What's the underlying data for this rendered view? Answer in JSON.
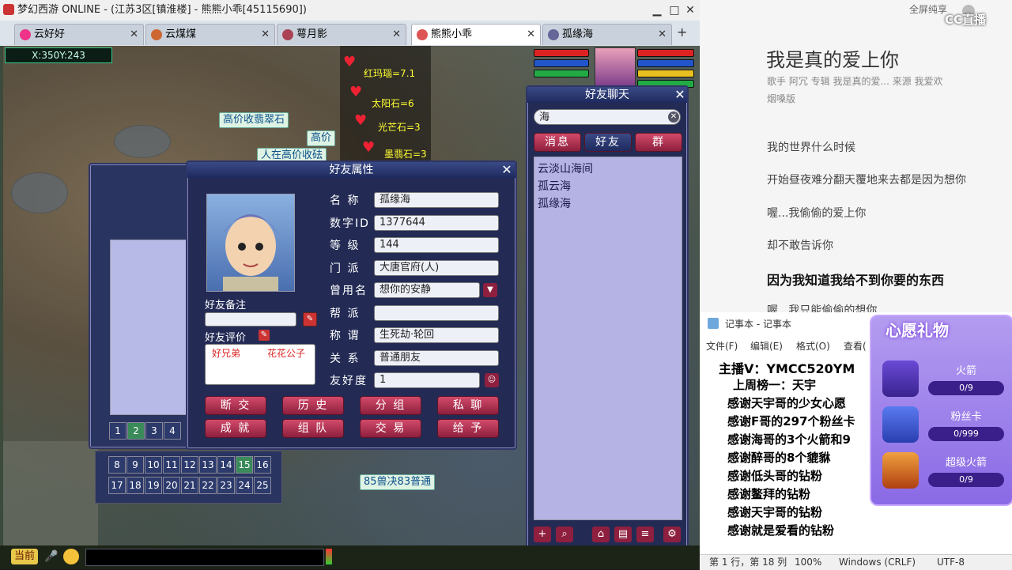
{
  "window": {
    "title": "梦幻西游 ONLINE - (江苏3区[镇淮楼] - 熊熊小乖[45115690])"
  },
  "tabs": [
    {
      "label": "云好好"
    },
    {
      "label": "云煤煤"
    },
    {
      "label": "萼月影"
    },
    {
      "label": "熊熊小乖"
    },
    {
      "label": "孤缘海"
    }
  ],
  "game": {
    "coords": "X:350Y:243",
    "tags": [
      "高价收翡翠石",
      "高价",
      "人在高价收砝",
      "85兽决83普通"
    ],
    "log_lines": [
      "红玛瑙=7.1",
      "太阳石=6",
      "光芒石=3",
      "墨翡石=3"
    ],
    "chat_button": "当前",
    "bottom_numbers": [
      "8",
      "9",
      "10",
      "11",
      "12",
      "13",
      "14",
      "15",
      "16",
      "17",
      "18",
      "19",
      "20",
      "21",
      "22",
      "23",
      "24",
      "25"
    ],
    "page_numbers": [
      "1",
      "2",
      "3",
      "4"
    ]
  },
  "friend_attr": {
    "title": "好友属性",
    "fields": [
      {
        "label": "名 称",
        "value": "孤缘海"
      },
      {
        "label": "数字ID",
        "value": "1377644"
      },
      {
        "label": "等 级",
        "value": "144"
      },
      {
        "label": "门 派",
        "value": "大唐官府(人)"
      },
      {
        "label": "曾用名",
        "value": "想你的安静"
      },
      {
        "label": "帮 派",
        "value": ""
      },
      {
        "label": "称 谓",
        "value": "生死劫·轮回"
      },
      {
        "label": "关 系",
        "value": "普通朋友"
      },
      {
        "label": "友好度",
        "value": "1"
      }
    ],
    "remark_label": "好友备注",
    "review_label": "好友评价",
    "reviews": [
      "好兄弟",
      "花花公子"
    ],
    "buttons_row1": [
      "断 交",
      "历 史",
      "分 组",
      "私 聊"
    ],
    "buttons_row2": [
      "成 就",
      "组 队",
      "交 易",
      "给 予"
    ]
  },
  "friend_chat": {
    "title": "好友聊天",
    "search_value": "海",
    "tabs": [
      "消息",
      "好友",
      "群"
    ],
    "results": [
      "云淡山海间",
      "孤云海",
      "孤缘海"
    ]
  },
  "music": {
    "top_link": "全屏纯享",
    "logo": "CC直播",
    "song_title": "我是真的爱上你",
    "meta": "歌手  阿冗      专辑  我是真的爱...      来源  我爱欢",
    "meta2": "烟嗓版",
    "lyrics": [
      "我的世界什么时候",
      "开始昼夜难分翻天覆地来去都是因为想你",
      "喔...我偷偷的爱上你",
      "却不敢告诉你",
      "因为我知道我给不到你要的东西",
      "喔...我只能偷偷的想你"
    ]
  },
  "notepad": {
    "title": "记事本 - 记事本",
    "menu": [
      "文件(F)",
      "编辑(E)",
      "格式(O)",
      "查看("
    ],
    "lines": [
      "主播V：YMCC520YM",
      "上周榜一：天宇",
      "感谢天宇哥的少女心愿",
      "感谢F哥的297个粉丝卡",
      "感谢海哥的3个火箭和9",
      "感谢醉哥的8个貔貅",
      "感谢低头哥的钻粉",
      "感谢鳌拜的钻粉",
      "感谢天宇哥的钻粉",
      "感谢就是爱看的钻粉"
    ],
    "status": [
      "第 1 行，第 18 列",
      "100%",
      "Windows (CRLF)",
      "UTF-8"
    ]
  },
  "wish": {
    "title": "心愿礼物",
    "items": [
      {
        "name": "火箭",
        "progress": "0/9"
      },
      {
        "name": "粉丝卡",
        "progress": "0/999"
      },
      {
        "name": "超级火箭",
        "progress": "0/9"
      }
    ]
  }
}
